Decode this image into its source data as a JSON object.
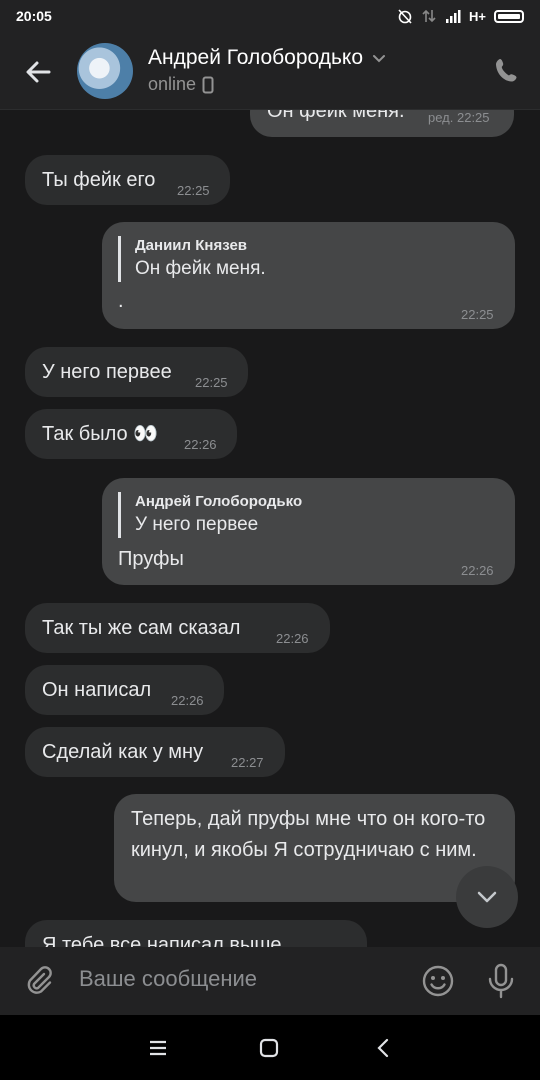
{
  "status_bar": {
    "time": "20:05",
    "network": "H+"
  },
  "header": {
    "contact_name": "Андрей Голобородько",
    "status": "online",
    "icons": [
      "back-arrow-icon",
      "chevron-down-icon",
      "mobile-phone-icon",
      "phone-call-icon"
    ]
  },
  "messages": [
    {
      "dir": "out",
      "text": "Он фейк меня.",
      "time": "ред. 22:25"
    },
    {
      "dir": "in",
      "text": "Ты фейк его",
      "time": "22:25"
    },
    {
      "dir": "out",
      "reply_author": "Даниил Князев",
      "reply_text": "Он фейк меня.",
      "text": ".",
      "time": "22:25"
    },
    {
      "dir": "in",
      "text": "У него первее",
      "time": "22:25"
    },
    {
      "dir": "in",
      "text": "Так было 👀",
      "time": "22:26"
    },
    {
      "dir": "out",
      "reply_author": "Андрей Голобородько",
      "reply_text": "У него первее",
      "text": "Пруфы",
      "time": "22:26"
    },
    {
      "dir": "in",
      "text": "Так ты же сам сказал",
      "time": "22:26"
    },
    {
      "dir": "in",
      "text": "Он написал",
      "time": "22:26"
    },
    {
      "dir": "in",
      "text": "Сделай как у мну",
      "time": "22:27"
    },
    {
      "dir": "out",
      "text": "Теперь, дай пруфы мне что он кого-то кинул, и якобы Я сотрудничаю с ним."
    },
    {
      "dir": "in",
      "text": "Я тебе все написал выше"
    }
  ],
  "composer": {
    "placeholder": "Ваше сообщение"
  },
  "colors": {
    "background": "#19191a",
    "incoming_bubble": "#2c2d2e",
    "outgoing_bubble": "#454647",
    "header": "#222223"
  }
}
